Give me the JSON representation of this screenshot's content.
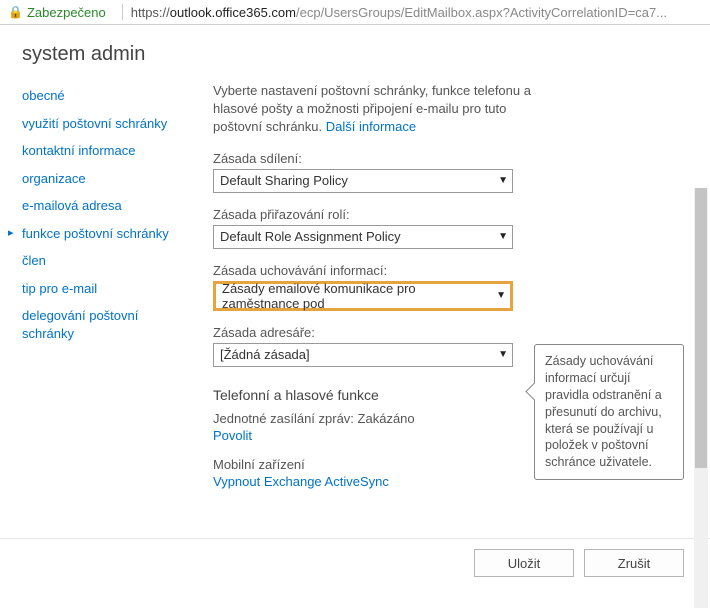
{
  "addr": {
    "secure": "Zabezpečeno",
    "scheme": "https://",
    "domain": "outlook.office365.com",
    "path": "/ecp/UsersGroups/EditMailbox.aspx?ActivityCorrelationID=ca7..."
  },
  "title": "system admin",
  "nav": [
    {
      "label": "obecné"
    },
    {
      "label": "využití poštovní schránky"
    },
    {
      "label": "kontaktní informace"
    },
    {
      "label": "organizace"
    },
    {
      "label": "e-mailová adresa"
    },
    {
      "label": "funkce poštovní schránky",
      "active": true
    },
    {
      "label": "člen"
    },
    {
      "label": "tip pro e-mail"
    },
    {
      "label": "delegování poštovní schránky"
    }
  ],
  "desc": {
    "text": "Vyberte nastavení poštovní schránky, funkce telefonu a hlasové pošty a možnosti připojení e-mailu pro tuto poštovní schránku.",
    "more": "Další informace"
  },
  "fields": {
    "sharing": {
      "label": "Zásada sdílení:",
      "value": "Default Sharing Policy"
    },
    "role": {
      "label": "Zásada přiřazování rolí:",
      "value": "Default Role Assignment Policy"
    },
    "retention": {
      "label": "Zásada uchovávání informací:",
      "value": "Zásady emailové komunikace pro zaměstnance pod"
    },
    "addressbook": {
      "label": "Zásada adresáře:",
      "value": "[Žádná zásada]"
    }
  },
  "phone": {
    "heading": "Telefonní a hlasové funkce",
    "um_label": "Jednotné zasílání zpráv:",
    "um_status": "Zakázáno",
    "enable": "Povolit",
    "mobile_heading": "Mobilní zařízení",
    "sync_link": "Vypnout Exchange ActiveSync"
  },
  "tooltip": "Zásady uchovávání informací určují pravidla odstranění a přesunutí do archivu, která se používají u položek v poštovní schránce uživatele.",
  "buttons": {
    "save": "Uložit",
    "cancel": "Zrušit"
  }
}
